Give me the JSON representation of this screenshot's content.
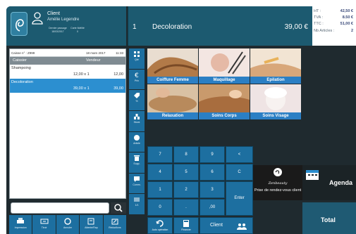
{
  "header": {
    "client_label": "Client",
    "client_name": "Amélie Legendre",
    "last_visit_label": "Dernier passage",
    "last_visit_date": "18/03/2017",
    "fidelity_label": "Carte fidélité",
    "fidelity_value": "0",
    "current_qty": "1",
    "current_item": "Decoloration",
    "current_price": "39,00 €",
    "ht_label": "HT :",
    "ht_value": "42,50 €",
    "tva_label": "TVA :",
    "tva_value": "8.50 €",
    "ttc_label": "TTC :",
    "ttc_value": "51,00 €",
    "articles_label": "Nb Articles :",
    "articles_value": "2"
  },
  "ticket": {
    "caisse": "Caisse n° : Z999",
    "date": "18 mars 2017",
    "time": "11:33",
    "col_caissier": "Caissier",
    "col_vendeur": "Vendeur",
    "lines": [
      {
        "name": "Shampoing",
        "qty": "12,00 x 1",
        "amount": "12,00"
      },
      {
        "name": "Decoloration",
        "qty": "39,00 x 1",
        "amount": "39,00"
      }
    ]
  },
  "bottom_bar": [
    "Impression",
    "Tiroir",
    "Annuler",
    "Attente/Rap",
    "Réductions"
  ],
  "side_bar": [
    "Qté",
    "Prix",
    "%",
    "Stock",
    "Article",
    "Supp.",
    "Comm.",
    "1/1"
  ],
  "categories": [
    {
      "label": "Coiffure Femme",
      "color": "#c9986b"
    },
    {
      "label": "Maquillage",
      "color": "#e8c8c0"
    },
    {
      "label": "Epilation",
      "color": "#d8a77a"
    },
    {
      "label": "Relaxation",
      "color": "#b88a5c"
    },
    {
      "label": "Soins Corps",
      "color": "#c98b55"
    },
    {
      "label": "Soins Visage",
      "color": "#ecd7d3"
    }
  ],
  "keypad": {
    "k7": "7",
    "k8": "8",
    "k9": "9",
    "back": "<",
    "k4": "4",
    "k5": "5",
    "k6": "6",
    "clear": "C",
    "k1": "1",
    "k2": "2",
    "k3": "3",
    "enter": "Enter",
    "k0": "0",
    "dot": ".",
    "k00": ",00"
  },
  "ops": {
    "auto": "Auto opération",
    "financer": "Financer",
    "client": "Client"
  },
  "rdv": {
    "label": "Prise de rendez-vous client",
    "brand": "Zenbeauty"
  },
  "agenda": "Agenda",
  "total": "Total",
  "colors": {
    "header": "#1c5a70",
    "button": "#1d6fa0",
    "selected": "#2c8fd0",
    "tile_label": "#2b7fc4"
  }
}
